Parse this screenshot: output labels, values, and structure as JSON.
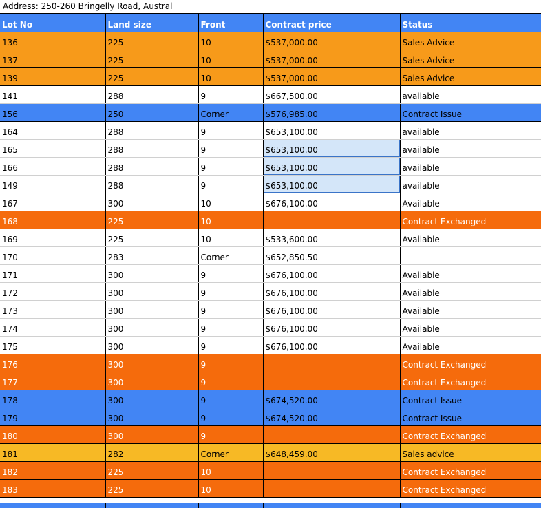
{
  "address": "Address: 250-260 Bringelly Road, Austral",
  "colors": {
    "header": "#4285f4",
    "orange": "#f79a1a",
    "blue": "#4285f4",
    "red": "#f56b0c",
    "yellow": "#f7b925",
    "selection": "#d4e6f9"
  },
  "columns": [
    "Lot No",
    "Land size",
    "Front",
    "Contract price",
    "Status"
  ],
  "rows": [
    {
      "lot": "136",
      "size": "225",
      "front": "10",
      "price": "$537,000.00",
      "status": "Sales Advice",
      "color": "orange"
    },
    {
      "lot": "137",
      "size": "225",
      "front": "10",
      "price": "$537,000.00",
      "status": "Sales Advice",
      "color": "orange"
    },
    {
      "lot": "139",
      "size": "225",
      "front": "10",
      "price": "$537,000.00",
      "status": "Sales Advice",
      "color": "orange"
    },
    {
      "lot": "141",
      "size": "288",
      "front": "9",
      "price": "$667,500.00",
      "status": "available",
      "color": "white"
    },
    {
      "lot": "156",
      "size": "250",
      "front": "Corner",
      "price": "$576,985.00",
      "status": "Contract Issue",
      "color": "blue"
    },
    {
      "lot": "164",
      "size": "288",
      "front": "9",
      "price": "$653,100.00",
      "status": "available",
      "color": "white"
    },
    {
      "lot": "165",
      "size": "288",
      "front": "9",
      "price": "$653,100.00",
      "status": "available",
      "color": "white",
      "selected": true
    },
    {
      "lot": "166",
      "size": "288",
      "front": "9",
      "price": "$653,100.00",
      "status": "available",
      "color": "white",
      "selected": true
    },
    {
      "lot": "149",
      "size": "288",
      "front": "9",
      "price": "$653,100.00",
      "status": "available",
      "color": "white",
      "selected": true
    },
    {
      "lot": "167",
      "size": "300",
      "front": "10",
      "price": "$676,100.00",
      "status": "Available",
      "color": "white"
    },
    {
      "lot": "168",
      "size": "225",
      "front": "10",
      "price": "",
      "status": "Contract Exchanged",
      "color": "red"
    },
    {
      "lot": "169",
      "size": "225",
      "front": "10",
      "price": "$533,600.00",
      "status": "Available",
      "color": "white"
    },
    {
      "lot": "170",
      "size": "283",
      "front": "Corner",
      "price": "$652,850.50",
      "status": "",
      "color": "white"
    },
    {
      "lot": "171",
      "size": "300",
      "front": "9",
      "price": "$676,100.00",
      "status": "Available",
      "color": "white"
    },
    {
      "lot": "172",
      "size": "300",
      "front": "9",
      "price": "$676,100.00",
      "status": "Available",
      "color": "white"
    },
    {
      "lot": "173",
      "size": "300",
      "front": "9",
      "price": "$676,100.00",
      "status": "Available",
      "color": "white"
    },
    {
      "lot": "174",
      "size": "300",
      "front": "9",
      "price": "$676,100.00",
      "status": "Available",
      "color": "white"
    },
    {
      "lot": "175",
      "size": "300",
      "front": "9",
      "price": "$676,100.00",
      "status": "Available",
      "color": "white"
    },
    {
      "lot": "176",
      "size": "300",
      "front": "9",
      "price": "",
      "status": "Contract Exchanged",
      "color": "red"
    },
    {
      "lot": "177",
      "size": "300",
      "front": "9",
      "price": "",
      "status": "Contract Exchanged",
      "color": "red"
    },
    {
      "lot": "178",
      "size": "300",
      "front": "9",
      "price": "$674,520.00",
      "status": "Contract Issue",
      "color": "blue"
    },
    {
      "lot": "179",
      "size": "300",
      "front": "9",
      "price": "$674,520.00",
      "status": "Contract Issue",
      "color": "blue"
    },
    {
      "lot": "180",
      "size": "300",
      "front": "9",
      "price": "",
      "status": "Contract Exchanged",
      "color": "red"
    },
    {
      "lot": "181",
      "size": "282",
      "front": "Corner",
      "price": "$648,459.00",
      "status": "Sales advice",
      "color": "yellow"
    },
    {
      "lot": "182",
      "size": "225",
      "front": "10",
      "price": "",
      "status": "Contract Exchanged",
      "color": "red"
    },
    {
      "lot": "183",
      "size": "225",
      "front": "10",
      "price": "",
      "status": "Contract Exchanged",
      "color": "red"
    }
  ]
}
